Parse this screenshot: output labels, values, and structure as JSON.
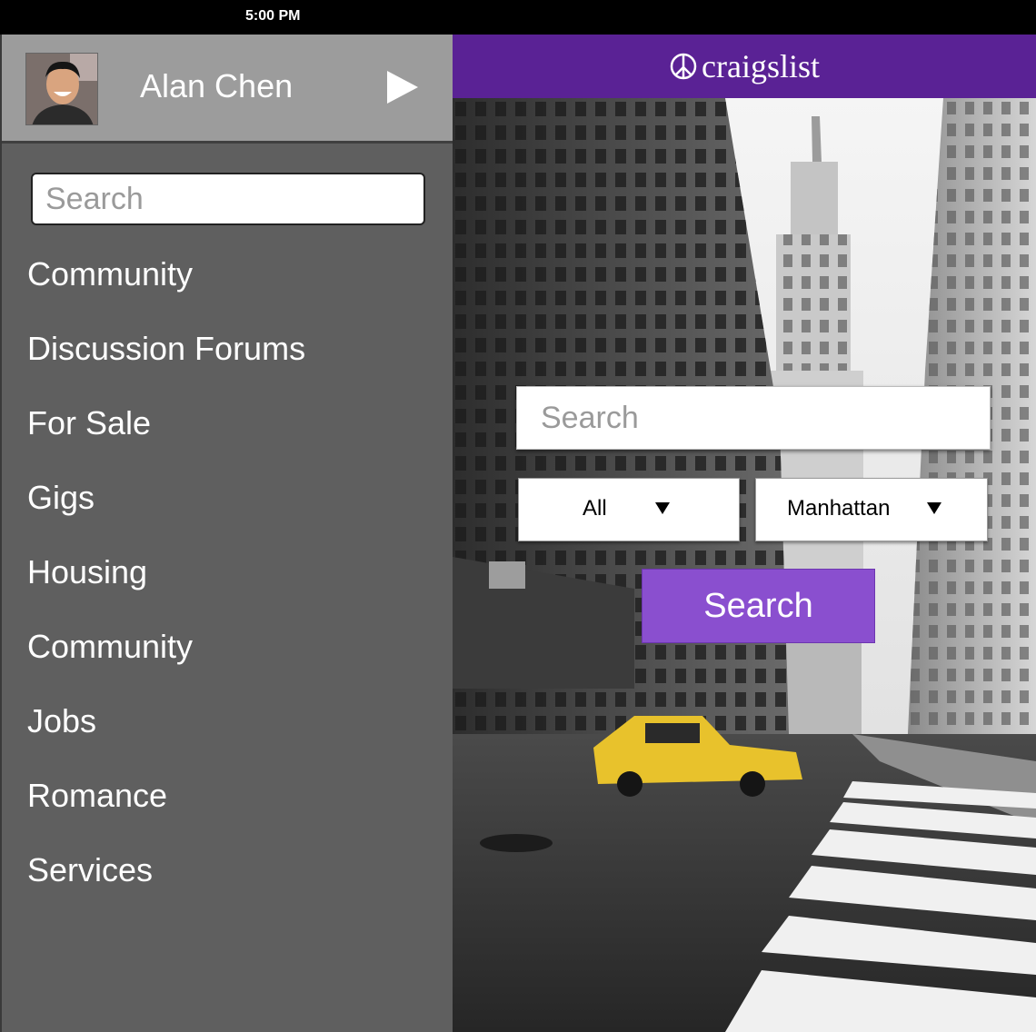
{
  "status_bar": {
    "time": "5:00 PM"
  },
  "sidebar": {
    "profile": {
      "name": "Alan Chen"
    },
    "search": {
      "placeholder": "Search"
    },
    "items": [
      {
        "label": "Community"
      },
      {
        "label": "Discussion Forums"
      },
      {
        "label": "For Sale"
      },
      {
        "label": "Gigs"
      },
      {
        "label": "Housing"
      },
      {
        "label": "Community"
      },
      {
        "label": "Jobs"
      },
      {
        "label": "Romance"
      },
      {
        "label": "Services"
      }
    ]
  },
  "header": {
    "brand": "craigslist",
    "color": "#5a2295"
  },
  "main": {
    "search": {
      "placeholder": "Search"
    },
    "category": {
      "value": "All"
    },
    "location": {
      "value": "Manhattan"
    },
    "search_button": {
      "label": "Search",
      "color": "#8a4fcf"
    }
  },
  "icons": [
    "peace-sign-icon",
    "play-arrow-icon",
    "caret-down-icon"
  ]
}
